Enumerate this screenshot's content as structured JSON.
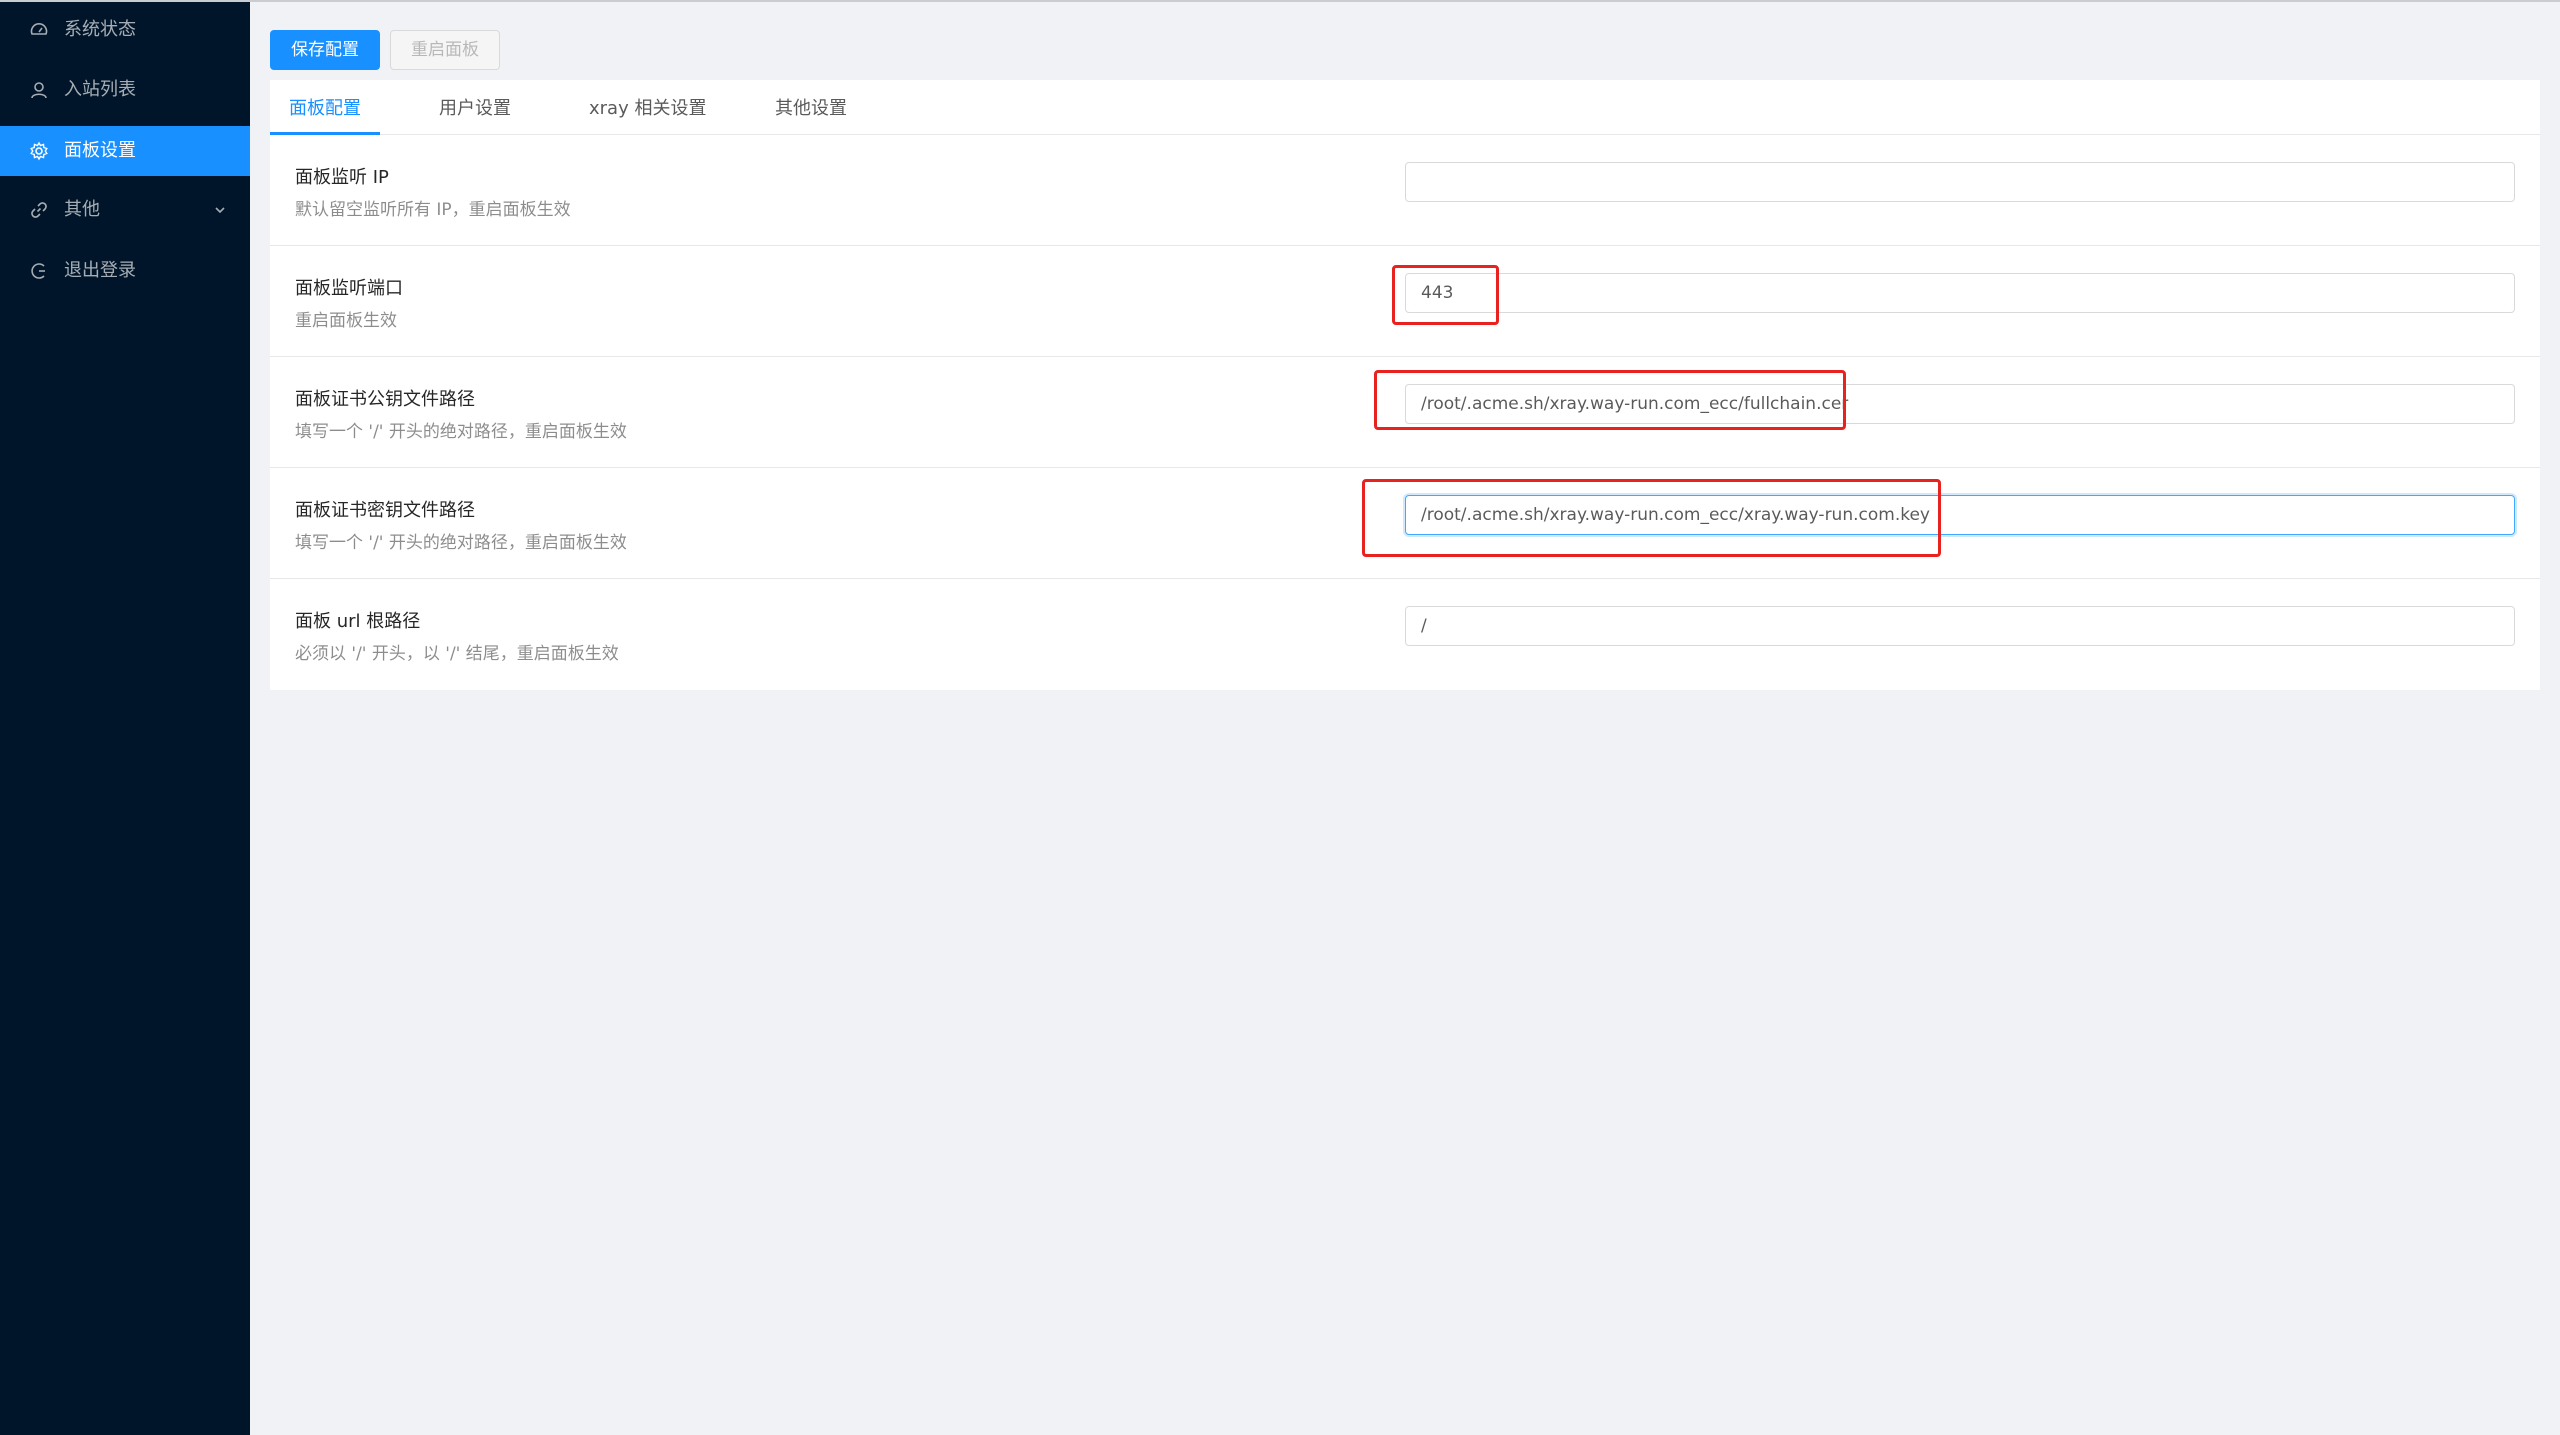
{
  "sidebar": {
    "items": [
      {
        "label": "系统状态",
        "icon": "dashboard-icon"
      },
      {
        "label": "入站列表",
        "icon": "user-icon"
      },
      {
        "label": "面板设置",
        "icon": "gear-icon",
        "active": true
      },
      {
        "label": "其他",
        "icon": "link-icon",
        "expandable": true
      },
      {
        "label": "退出登录",
        "icon": "logout-icon"
      }
    ]
  },
  "toolbar": {
    "save_label": "保存配置",
    "restart_label": "重启面板"
  },
  "tabs": [
    {
      "label": "面板配置",
      "active": true
    },
    {
      "label": "用户设置"
    },
    {
      "label": "xray 相关设置"
    },
    {
      "label": "其他设置"
    }
  ],
  "settings": [
    {
      "title": "面板监听 IP",
      "desc": "默认留空监听所有 IP，重启面板生效",
      "value": ""
    },
    {
      "title": "面板监听端口",
      "desc": "重启面板生效",
      "value": "443"
    },
    {
      "title": "面板证书公钥文件路径",
      "desc": "填写一个 '/' 开头的绝对路径，重启面板生效",
      "value": "/root/.acme.sh/xray.way-run.com_ecc/fullchain.cer"
    },
    {
      "title": "面板证书密钥文件路径",
      "desc": "填写一个 '/' 开头的绝对路径，重启面板生效",
      "value": "/root/.acme.sh/xray.way-run.com_ecc/xray.way-run.com.key"
    },
    {
      "title": "面板 url 根路径",
      "desc": "必须以 '/' 开头，以 '/' 结尾，重启面板生效",
      "value": "/"
    }
  ],
  "colors": {
    "sidebar_bg": "#001529",
    "accent": "#1890ff",
    "annotation": "#e8231f",
    "page_bg": "#f0f2f5"
  }
}
